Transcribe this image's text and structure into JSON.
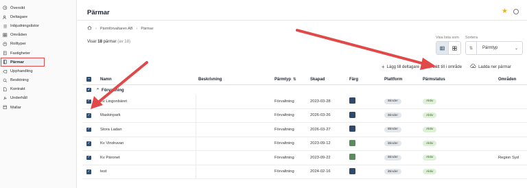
{
  "sidebar": {
    "items": [
      {
        "label": "Översikt",
        "icon": "clock-icon"
      },
      {
        "label": "Deltagare",
        "icon": "users-icon"
      },
      {
        "label": "Inbjudningslistor",
        "icon": "list-icon"
      },
      {
        "label": "Områden",
        "icon": "grid-icon"
      },
      {
        "label": "Rolltyper",
        "icon": "role-icon"
      },
      {
        "label": "Fastigheter",
        "icon": "building-icon"
      },
      {
        "label": "Pärmar",
        "icon": "binder-icon",
        "active": true
      },
      {
        "label": "Upphandling",
        "icon": "procurement-icon"
      },
      {
        "label": "Besiktning",
        "icon": "inspection-icon"
      },
      {
        "label": "Kontrakt",
        "icon": "contract-icon"
      },
      {
        "label": "Underhåll",
        "icon": "maintenance-icon"
      },
      {
        "label": "Mallar",
        "icon": "template-icon"
      }
    ]
  },
  "header": {
    "title": "Pärmar",
    "star": "★"
  },
  "breadcrumb": {
    "items": [
      "Pärmförvaltaren AB",
      "Pärmar"
    ],
    "sep": "›"
  },
  "listing": {
    "count_prefix": "Visar",
    "count": "18",
    "count_unit": "pärmar",
    "count_total": "(av 18)"
  },
  "controls": {
    "view_label": "Visa lista som",
    "sort_label": "Sortera",
    "sort_value": "Pärmtyp",
    "sort_icon": "⇅",
    "chevron": "⌄"
  },
  "actions": [
    {
      "label": "Lägg till deltagare",
      "icon": "+"
    },
    {
      "label": "Lätt till i område",
      "icon": "+"
    },
    {
      "label": "Ladda ner pärmar",
      "icon": "cloud-download-icon"
    }
  ],
  "table": {
    "headers": {
      "name": "Namn",
      "description": "Beskrivning",
      "type": "Pärmtyp",
      "created": "Skapad",
      "color": "Färg",
      "platform": "Plattform",
      "status": "Pärmstatus",
      "area": "Områden"
    },
    "type_sort_icon": "⇅",
    "group_label": "Förvaltning",
    "group_caret": "⌃",
    "rows": [
      {
        "name": "Kv Lingonbäret",
        "description": "",
        "type": "Förvaltning",
        "created": "2023-03-28",
        "color": "#2d4a6b",
        "platform": "iBinder",
        "status": "Aktiv",
        "area": ""
      },
      {
        "name": "Maskinpark",
        "description": "",
        "type": "Förvaltning",
        "created": "2026-03-26",
        "color": "#2d4a6b",
        "platform": "iBinder",
        "status": "Aktiv",
        "area": ""
      },
      {
        "name": "Stora Ladan",
        "description": "",
        "type": "Förvaltning",
        "created": "2026-03-27",
        "color": "#2d4a6b",
        "platform": "iBinder",
        "status": "Aktiv",
        "area": ""
      },
      {
        "name": "Kv Vindruvan",
        "description": "",
        "type": "Förvaltning",
        "created": "2023-09-12",
        "color": "#5a8a5e",
        "platform": "iBinder",
        "status": "Aktiv",
        "area": ""
      },
      {
        "name": "Kv Päronet",
        "description": "",
        "type": "Förvaltning",
        "created": "2023-09-22",
        "color": "#5a8a5e",
        "platform": "iBinder",
        "status": "Aktiv",
        "area": "Region Syd"
      },
      {
        "name": "test",
        "description": "",
        "type": "Förvaltning",
        "created": "2024-02-16",
        "color": "#2d4a6b",
        "platform": "iBinder",
        "status": "Aktiv",
        "area": ""
      }
    ]
  },
  "colors": {
    "accent": "#2d4f73",
    "annotation": "#e34848",
    "star": "#f2b100"
  }
}
